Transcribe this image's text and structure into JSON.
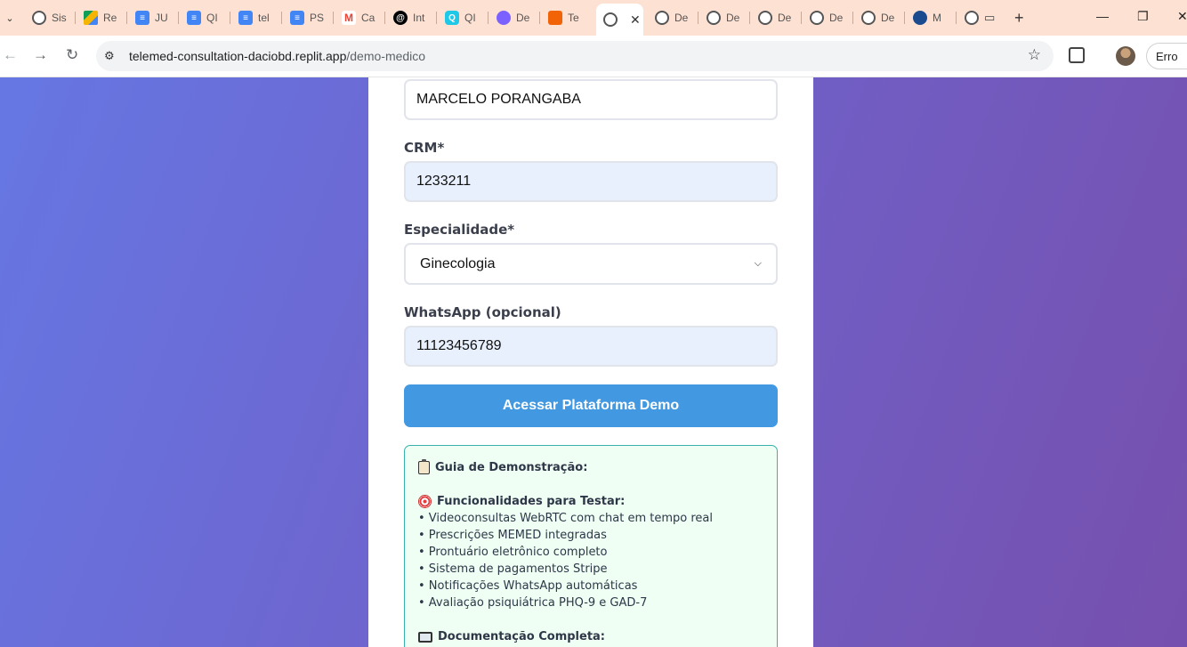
{
  "browser": {
    "tabs": [
      {
        "icon": "globe-icon",
        "label": "Sis"
      },
      {
        "icon": "drive-icon",
        "label": "Re"
      },
      {
        "icon": "docs-icon",
        "label": "JU"
      },
      {
        "icon": "docs-icon",
        "label": "QI"
      },
      {
        "icon": "docs-icon",
        "label": "tel"
      },
      {
        "icon": "docs-icon",
        "label": "PS"
      },
      {
        "icon": "gmail-icon",
        "label": "Ca"
      },
      {
        "icon": "threads-icon",
        "label": "Int"
      },
      {
        "icon": "q-icon",
        "label": "QI"
      },
      {
        "icon": "chat-icon",
        "label": "De"
      },
      {
        "icon": "replit-icon",
        "label": "Te"
      },
      {
        "icon": "globe-icon",
        "label": ""
      },
      {
        "icon": "globe-icon",
        "label": "De"
      },
      {
        "icon": "globe-icon",
        "label": "De"
      },
      {
        "icon": "globe-icon",
        "label": "De"
      },
      {
        "icon": "globe-icon",
        "label": "De"
      },
      {
        "icon": "globe-icon",
        "label": "De"
      },
      {
        "icon": "m-icon",
        "label": "M"
      },
      {
        "icon": "globe-icon",
        "label": ""
      }
    ],
    "url_host": "telemed-consultation-daciobd.replit.app",
    "url_path": "/demo-medico",
    "profile_button": "Erro"
  },
  "form": {
    "name_value": "MARCELO PORANGABA",
    "crm_label": "CRM*",
    "crm_value": "1233211",
    "specialty_label": "Especialidade*",
    "specialty_value": "Ginecologia",
    "whatsapp_label": "WhatsApp (opcional)",
    "whatsapp_value": "11123456789",
    "submit_label": "Acessar Plataforma Demo"
  },
  "guide": {
    "title": "Guia de Demonstração:",
    "features_title": "Funcionalidades para Testar:",
    "features": [
      "• Videoconsultas WebRTC com chat em tempo real",
      "• Prescrições MEMED integradas",
      "• Prontuário eletrônico completo",
      "• Sistema de pagamentos Stripe",
      "• Notificações WhatsApp automáticas",
      "• Avaliação psiquiátrica PHQ-9 e GAD-7"
    ],
    "docs_title": "Documentação Completa:"
  }
}
